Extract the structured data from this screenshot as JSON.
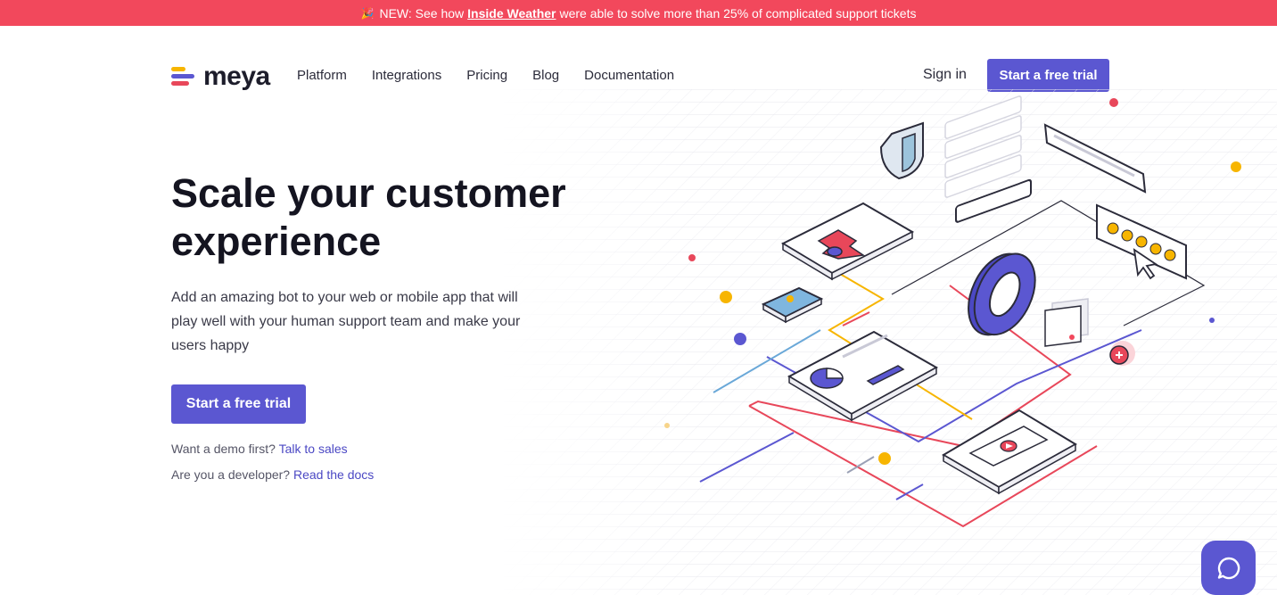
{
  "banner": {
    "emoji": "🎉",
    "prefix": "NEW: See how",
    "link": "Inside Weather",
    "suffix": "were able to solve more than 25% of complicated support tickets"
  },
  "brand": {
    "name": "meya",
    "colors": {
      "accent": "#5b57d1",
      "banner": "#f2485c",
      "yellow": "#f7b500",
      "red": "#e8475a",
      "blue": "#5b57d1"
    }
  },
  "nav": {
    "items": [
      "Platform",
      "Integrations",
      "Pricing",
      "Blog",
      "Documentation"
    ],
    "signin": "Sign in",
    "cta": "Start a free trial"
  },
  "hero": {
    "title": "Scale your customer experience",
    "subtitle": "Add an amazing bot to your web or mobile app that will play well with your human support team and make your users happy",
    "cta": "Start a free trial",
    "demo_prefix": "Want a demo first?",
    "demo_link": "Talk to sales",
    "dev_prefix": "Are you a developer?",
    "dev_link": "Read the docs"
  },
  "icons": {
    "chat": "chat-bubble-icon",
    "logo": "meya-logo-icon"
  }
}
